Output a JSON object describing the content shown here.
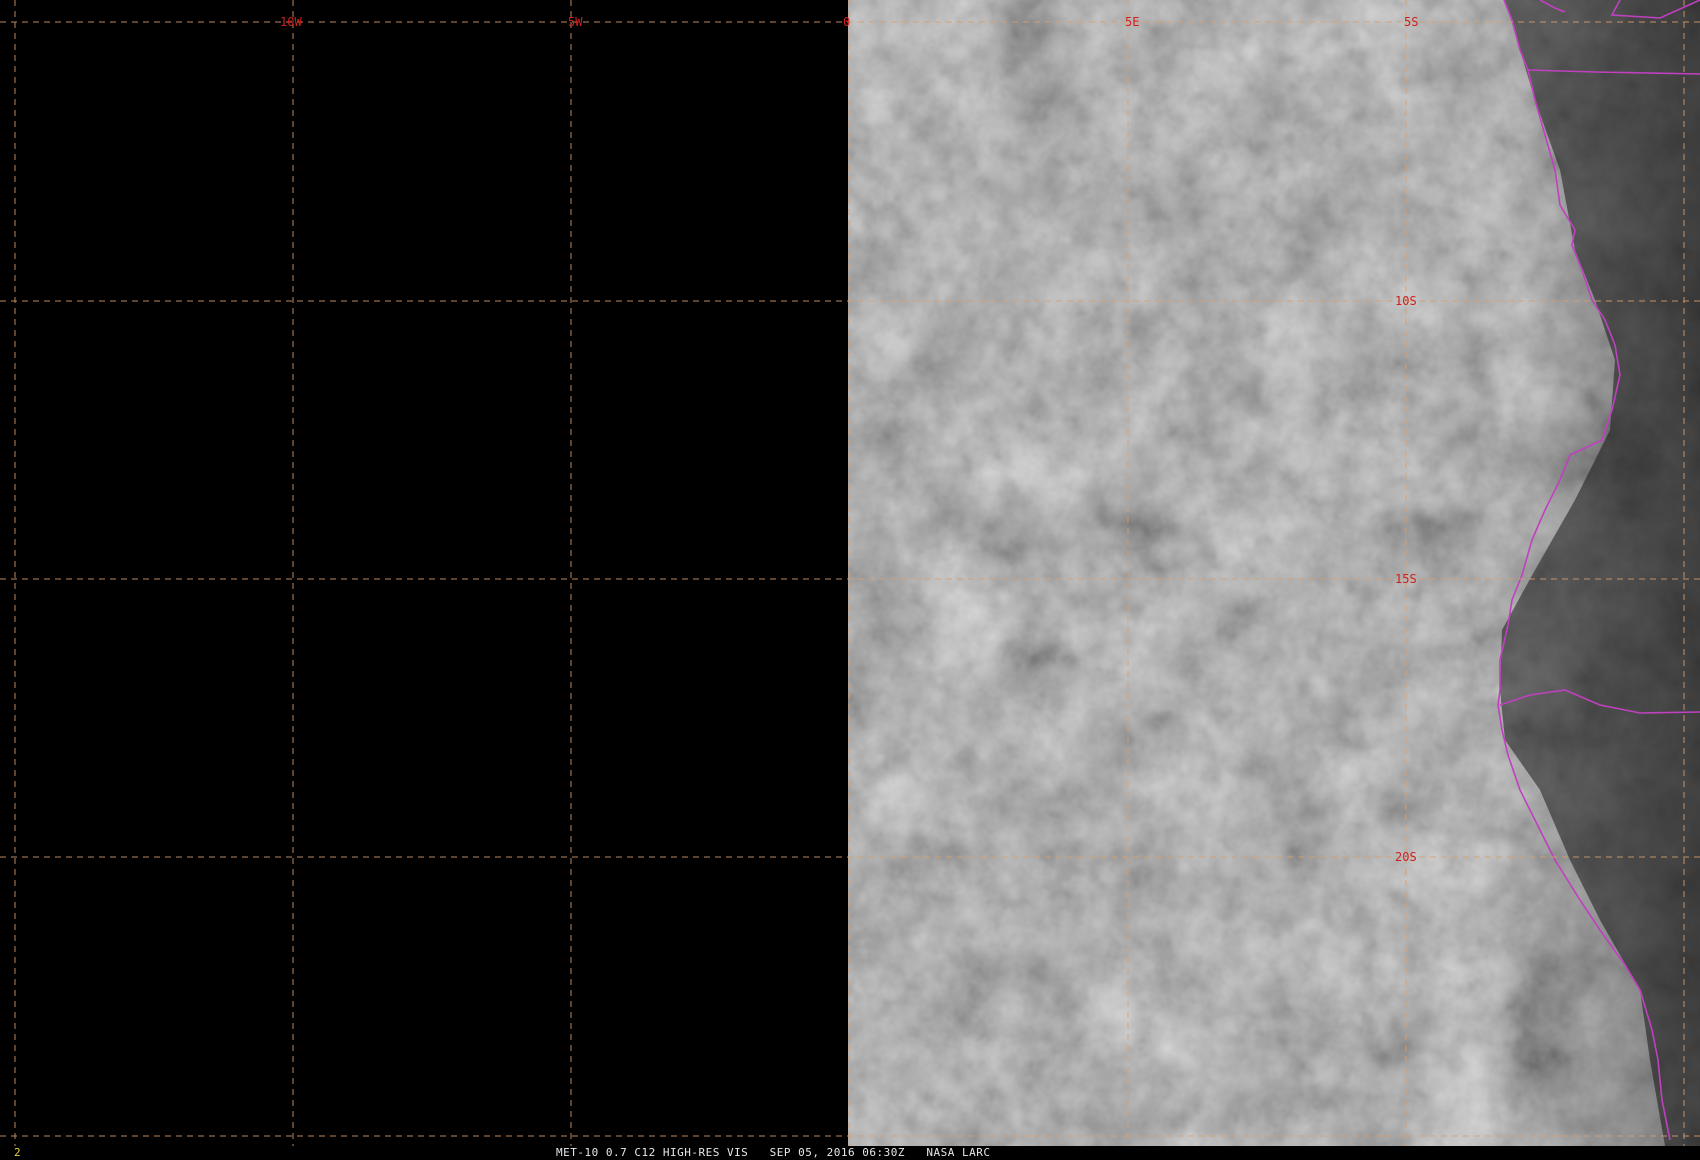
{
  "colors": {
    "background": "#000000",
    "grid_line": "#d8a070",
    "grid_label": "#cc2020",
    "border_line": "#c040c0",
    "frame_number": "#e6d23c",
    "caption_text": "#e8e8e8"
  },
  "grid": {
    "longitude_labels": [
      "10W",
      "5W",
      "0",
      "5E",
      "5S"
    ],
    "latitude_labels": [
      "10S",
      "15S",
      "20S"
    ]
  },
  "imagery": {
    "description_icon": "satellite-cloud-imagery",
    "coverage": "right-half"
  },
  "status": {
    "frame_number": "2",
    "caption": "MET-10 0.7 C12 HIGH-RES VIS   SEP 05, 2016 06:30Z   NASA LARC"
  }
}
